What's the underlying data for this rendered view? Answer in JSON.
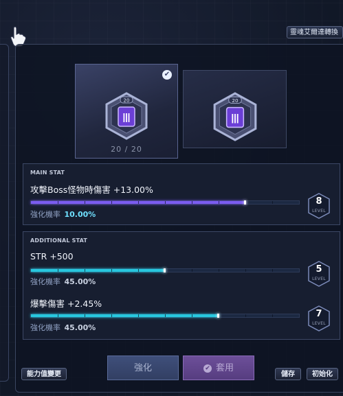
{
  "header": {
    "tab_label": "靈魂艾爾達轉換"
  },
  "cards": [
    {
      "roman": "Ⅲ",
      "level_badge": "20",
      "selected": true,
      "count": "20 / 20"
    },
    {
      "roman": "Ⅲ",
      "level_badge": "20",
      "selected": false
    }
  ],
  "main_stat": {
    "title": "MAIN STAT",
    "name": "攻擊Boss怪物時傷害 +13.00%",
    "progress_fraction": 0.8,
    "bar_color": "#7b5cf0",
    "rate_label": "強化機率",
    "rate_value": "10.00%",
    "level": "8",
    "level_label": "LEVEL"
  },
  "additional_stat": {
    "title": "ADDITIONAL STAT",
    "stats": [
      {
        "name": "STR +500",
        "progress_fraction": 0.5,
        "bar_color": "#27c7de",
        "rate_label": "強化機率",
        "rate_value": "45.00%",
        "level": "5",
        "level_label": "LEVEL"
      },
      {
        "name": "爆擊傷害 +2.45%",
        "progress_fraction": 0.7,
        "bar_color": "#27c7de",
        "rate_label": "強化機率",
        "rate_value": "45.00%",
        "level": "7",
        "level_label": "LEVEL"
      }
    ]
  },
  "buttons": {
    "change_stat": "能力值變更",
    "enhance": "強化",
    "apply": "套用",
    "save": "儲存",
    "reset": "初始化"
  },
  "colors": {
    "main_rate": "#6fe0ff",
    "add_rate": "#c8d0e0"
  }
}
